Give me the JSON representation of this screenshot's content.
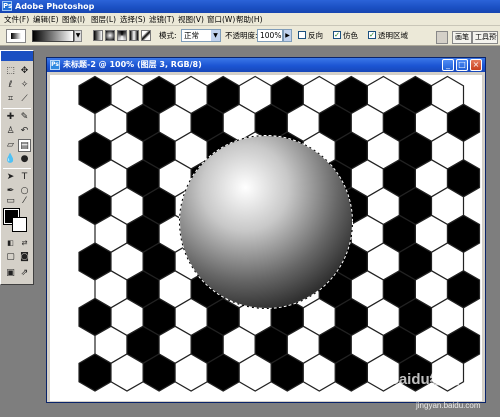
{
  "app": {
    "title": "Adobe Photoshop",
    "icon": "Ps"
  },
  "menu": [
    "文件(F)",
    "编辑(E)",
    "图像(I)",
    "图层(L)",
    "选择(S)",
    "滤镜(T)",
    "视图(V)",
    "窗口(W)",
    "帮助(H)"
  ],
  "options_bar": {
    "mode_label": "模式:",
    "mode_value": "正常",
    "opacity_label": "不透明度:",
    "opacity_value": "100%",
    "reverse_label": "反向",
    "dither_label": "仿色",
    "transparency_label": "透明区域",
    "well_tab_1": "画笔",
    "well_tab_2": "工具预设"
  },
  "document": {
    "title": "未标题-2 @ 100% (图层 3, RGB/8)",
    "icon": "Ps"
  },
  "canvas": {
    "hex_fill_colors": [
      "#000000",
      "#ffffff"
    ],
    "sphere_gradient": [
      "#ffffff",
      "#303030"
    ]
  },
  "watermark": {
    "logo": "Baidu经验",
    "url": "jingyan.baidu.com"
  }
}
